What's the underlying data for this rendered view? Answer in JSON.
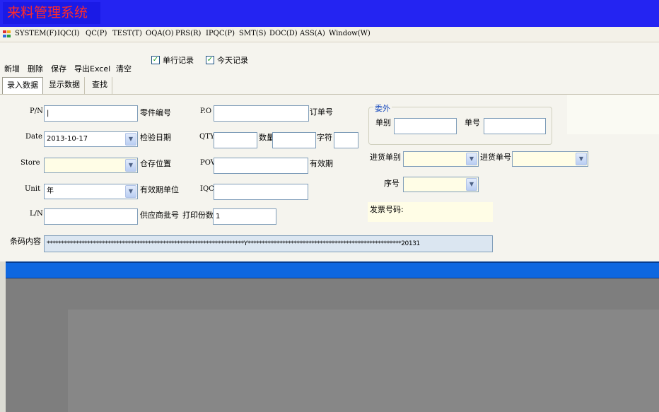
{
  "window": {
    "title": "来料管理系统"
  },
  "menu": [
    "SYSTEM(F)",
    "IQC(I)",
    "QC(P)",
    "TEST(T)",
    "OQA(O)",
    "PRS(R)",
    "IPQC(P)",
    "SMT(S)",
    "DOC(D)",
    "ASS(A)",
    "Window(W)"
  ],
  "toolbar": {
    "add": "新增",
    "delete": "删除",
    "save": "保存",
    "export": "导出Excel",
    "clear": "清空"
  },
  "checks": [
    {
      "label": "单行记录",
      "checked": true
    },
    {
      "label": "今天记录",
      "checked": true
    }
  ],
  "tabs": [
    "录入数据",
    "显示数据",
    "查找"
  ],
  "form": {
    "pn_label": "P/N",
    "pn_value": "|",
    "part_no_label": "零件编号",
    "date_label": "Date",
    "date_value": "2013-10-17",
    "inspect_date_label": "检验日期",
    "store_label": "Store",
    "store_value": "",
    "location_label": "仓存位置",
    "unit_label": "Unit",
    "unit_value": "年",
    "validity_unit_label": "有效期单位",
    "ln_label": "L/N",
    "ln_value": "",
    "supplier_batch_label": "供应商批号",
    "po_label": "P.O",
    "po_value": "",
    "order_no_label": "订单号",
    "qty_label": "QTY",
    "qty_value": "",
    "quantity_label": "数量",
    "quantity_value": "",
    "char_label": "字符",
    "char_value": "",
    "pov_label": "POV",
    "pov_value": "",
    "validity_label": "有效期",
    "iqc_label": "IQC",
    "iqc_value": "",
    "print_copies_label": "打印份数",
    "print_copies_value": "1",
    "outsource_legend": "委外",
    "doc_type_label": "单别",
    "doc_type_value": "",
    "doc_no_label": "单号",
    "doc_no_value": "",
    "inbound_type_label": "进货单别",
    "inbound_type_value": "",
    "inbound_no_label": "进货单号",
    "inbound_no_value": "",
    "seq_label": "序号",
    "seq_value": "",
    "invoice_label": "发票号码:",
    "barcode_label": "条码内容",
    "barcode_value": "********************************************************************Y*****************************************************20131"
  },
  "colors": {
    "title_bar": "#2424f2",
    "title_text": "#ff2a2a",
    "status_bar": "#0e67e0",
    "mdi_area": "#7e7e7e"
  }
}
